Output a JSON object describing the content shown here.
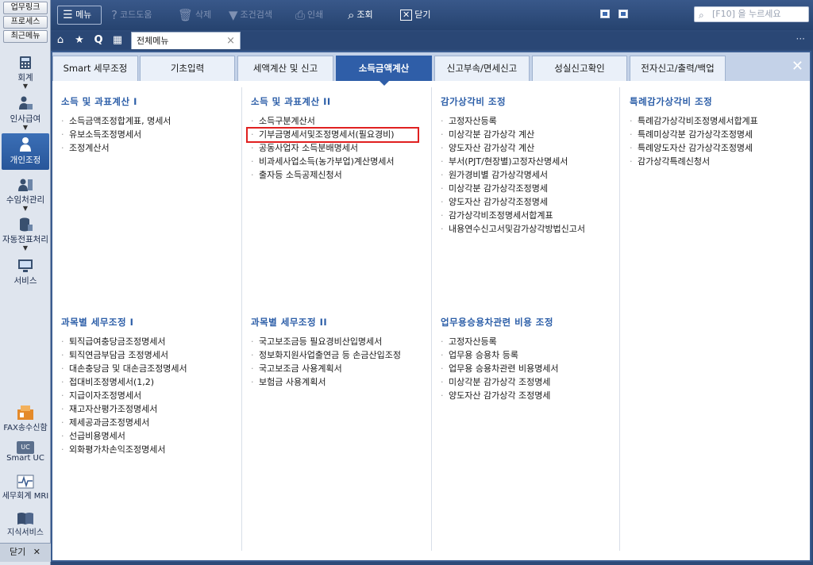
{
  "left_panel": {
    "top_buttons": [
      "업무링크",
      "프로세스",
      "최근메뉴"
    ],
    "nav": [
      {
        "label": "회계",
        "icon": "calculator-icon"
      },
      {
        "label": "인사급여",
        "icon": "person-money-icon"
      },
      {
        "label": "개인조정",
        "icon": "person-icon"
      },
      {
        "label": "수임처관리",
        "icon": "client-building-icon"
      },
      {
        "label": "자동전표처리",
        "icon": "database-icon"
      },
      {
        "label": "서비스",
        "icon": "monitor-icon"
      }
    ],
    "bottom": [
      {
        "label": "FAX송수신함",
        "icon": "fax-icon"
      },
      {
        "label": "Smart UC",
        "icon": "uc-icon"
      },
      {
        "label": "세무회계 MRI",
        "icon": "pulse-icon"
      },
      {
        "label": "지식서비스",
        "icon": "book-icon"
      }
    ],
    "close_label": "닫기",
    "close_glyph": "✕"
  },
  "toolbar": {
    "menu": "메뉴",
    "code_help": "코드도움",
    "delete": "삭제",
    "filter": "조건검색",
    "print": "인쇄",
    "search": "조회",
    "close": "닫기",
    "search_placeholder": "[F10] 을 누르세요"
  },
  "tabbar": {
    "doc_tab": "전체메뉴"
  },
  "categories": [
    {
      "label": "Smart 세무조정"
    },
    {
      "label": "기초입력"
    },
    {
      "label": "세액계산 및 신고"
    },
    {
      "label": "소득금액계산",
      "active": true
    },
    {
      "label": "신고부속/면세신고"
    },
    {
      "label": "성실신고확인"
    },
    {
      "label": "전자신고/출력/백업"
    }
  ],
  "sections": {
    "s1": {
      "title": "소득 및 과표계산 I",
      "items": [
        "소득금액조정합계표, 명세서",
        "유보소득조정명세서",
        "조정계산서"
      ]
    },
    "s2": {
      "title": "소득 및 과표계산 II",
      "items": [
        "소득구분계산서",
        "기부금명세서및조정명세서(필요경비)",
        "공동사업자 소득분배명세서",
        "비과세사업소득(농가부업)계산명세서",
        "출자등 소득공제신청서"
      ]
    },
    "s3": {
      "title": "감가상각비 조정",
      "items": [
        "고정자산등록",
        "미상각분 감가상각 계산",
        "양도자산 감가상각 계산",
        "부서(PJT/현장별)고정자산명세서",
        "원가경비별 감가상각명세서",
        "미상각분 감가상각조정명세",
        "양도자산 감가상각조정명세",
        "감가상각비조정명세서합계표",
        "내용연수신고서및감가상각방법신고서"
      ]
    },
    "s4": {
      "title": "특례감가상각비 조정",
      "items": [
        "특례감가상각비조정명세서합계표",
        "특례미상각분 감가상각조정명세",
        "특례양도자산 감가상각조정명세",
        "감가상각특례신청서"
      ]
    },
    "s5": {
      "title": "과목별 세무조정 I",
      "items": [
        "퇴직급여충당금조정명세서",
        "퇴직연금부담금 조정명세서",
        "대손충당금 및 대손금조정명세서",
        "접대비조정명세서(1,2)",
        "지급이자조정명세서",
        "재고자산평가조정명세서",
        "제세공과금조정명세서",
        "선급비용명세서",
        "외화평가차손익조정명세서"
      ]
    },
    "s6": {
      "title": "과목별 세무조정 II",
      "items": [
        "국고보조금등 필요경비산입명세서",
        "정보화지원사업출연금 등 손금산입조정",
        "국고보조금 사용계획서",
        "보험금 사용계획서"
      ]
    },
    "s7": {
      "title": "업무용승용차관련 비용 조정",
      "items": [
        "고정자산등록",
        "업무용 승용차 등록",
        "업무용 승용차관련 비용명세서",
        "미상각분 감가상각 조정명세",
        "양도자산 감가상각 조정명세"
      ]
    }
  },
  "colors": {
    "accent": "#2f5ea8",
    "highlight": "#e02020",
    "toolbar": "#2d4a78"
  }
}
